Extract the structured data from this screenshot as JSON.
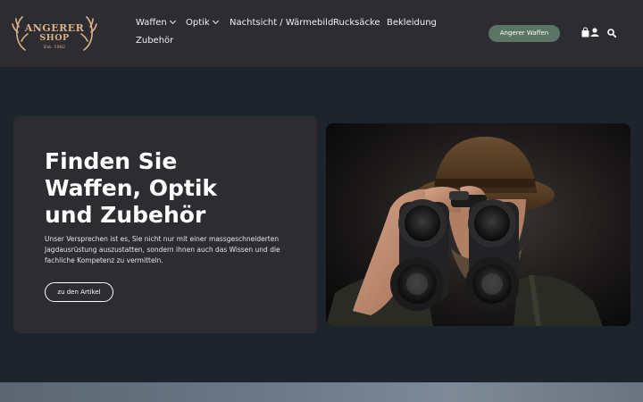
{
  "brand": {
    "line1": "ANGERER",
    "line2": "SHOP",
    "est": "Est. 1982",
    "color": "#d9b48a"
  },
  "nav": {
    "items": [
      {
        "label": "Waffen",
        "dropdown": true
      },
      {
        "label": "Optik",
        "dropdown": true
      },
      {
        "label": "Nachtsicht / Wärmebild",
        "dropdown": false
      },
      {
        "label": "Rucksäcke",
        "dropdown": false
      },
      {
        "label": "Bekleidung",
        "dropdown": false
      },
      {
        "label": "Zubehör",
        "dropdown": false
      }
    ]
  },
  "header": {
    "cta_label": "Angerer Waffen",
    "cta_color": "#5a7564",
    "icons": [
      "shopping-bag-icon",
      "user-icon",
      "search-icon"
    ]
  },
  "hero": {
    "title_lines": [
      "Finden Sie",
      "Waffen, Optik",
      "und Zubehör"
    ],
    "text": "Unser Versprechen ist es, Sie nicht nur mit einer massgeschneiderten Jagdausrüstung auszustatten, sondern ihnen auch das Wissen und die fachliche Kompetenz zu vermitteln.",
    "button_label": "zu den Artikel",
    "image": "hunter-with-binoculars"
  },
  "colors": {
    "page_bg": "#1d242b",
    "header_bg": "#2d2c31",
    "card_bg": "#2d2c31"
  }
}
